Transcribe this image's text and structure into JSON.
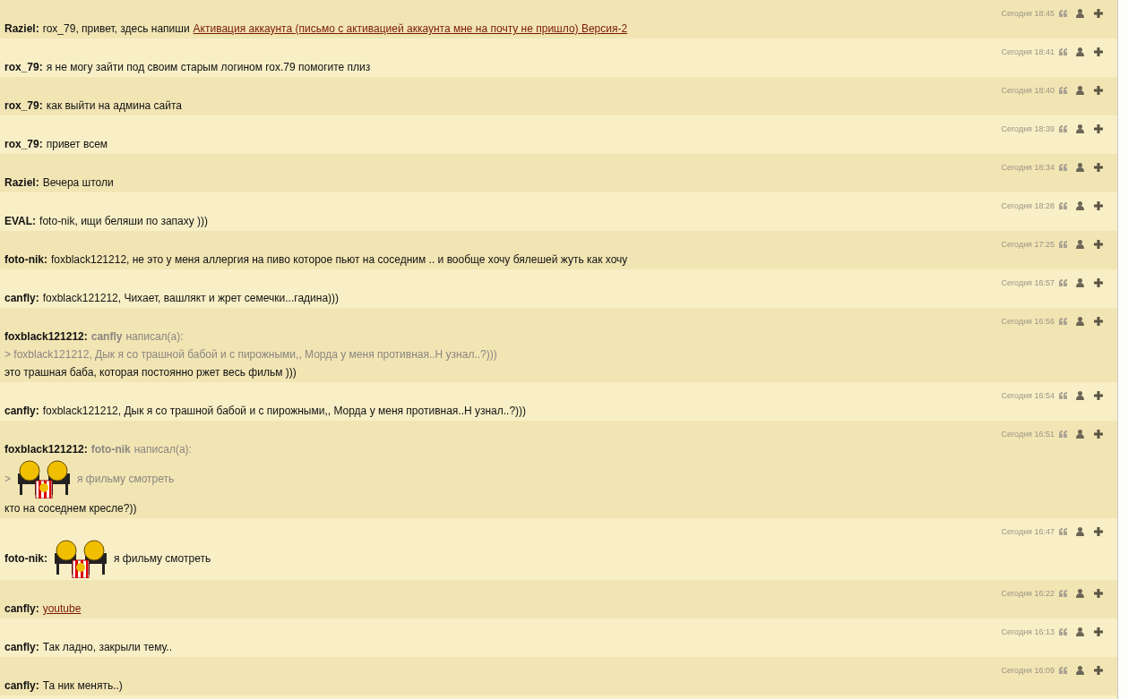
{
  "messages": [
    {
      "time": "Сегодня 18:45",
      "author": "Raziel:",
      "lines": [
        [
          {
            "kind": "text",
            "text": "rox_79, привет, здесь напиши"
          },
          {
            "kind": "link",
            "text": "Активация аккаунта (письмо с активацией аккаунта мне на почту не пришло) Версия-2"
          }
        ]
      ]
    },
    {
      "time": "Сегодня 18:41",
      "author": "rox_79:",
      "lines": [
        [
          {
            "kind": "text",
            "text": "я не могу зайти под своим старым логином rox.79 помогите плиз"
          }
        ]
      ]
    },
    {
      "time": "Сегодня 18:40",
      "author": "rox_79:",
      "lines": [
        [
          {
            "kind": "text",
            "text": "как выйти на админа сайта"
          }
        ]
      ]
    },
    {
      "time": "Сегодня 18:39",
      "author": "rox_79:",
      "lines": [
        [
          {
            "kind": "text",
            "text": "привет всем"
          }
        ]
      ]
    },
    {
      "time": "Сегодня 18:34",
      "author": "Raziel:",
      "lines": [
        [
          {
            "kind": "text",
            "text": "Вечера штоли"
          }
        ]
      ]
    },
    {
      "time": "Сегодня 18:28",
      "author": "EVAL:",
      "lines": [
        [
          {
            "kind": "text",
            "text": "foto-nik, ищи беляши по запаху )))"
          }
        ]
      ]
    },
    {
      "time": "Сегодня 17:25",
      "author": "foto-nik:",
      "lines": [
        [
          {
            "kind": "text",
            "text": "foxblack121212, не это у меня аллергия на пиво которое пьют на соседним .. и вообще хочу бялешей жуть как хочу"
          }
        ]
      ]
    },
    {
      "time": "Сегодня 16:57",
      "author": "canfly:",
      "lines": [
        [
          {
            "kind": "text",
            "text": "foxblack121212, Чихает, вашлякт и жрет семечки...гадина)))"
          }
        ]
      ]
    },
    {
      "time": "Сегодня 16:56",
      "author": "foxblack121212:",
      "lines": [
        [
          {
            "kind": "quote-author",
            "text": "canfly"
          },
          {
            "kind": "quote-text",
            "text": "написал(а):"
          }
        ],
        [
          {
            "kind": "quote-text",
            "text": "> foxblack121212, Дык я со трашной бабой и с пирожными,, Морда у меня противная..Н узнал..?)))"
          }
        ],
        [
          {
            "kind": "text",
            "text": "это трашная баба, которая постоянно ржет весь фильм )))"
          }
        ]
      ]
    },
    {
      "time": "Сегодня 16:54",
      "author": "canfly:",
      "lines": [
        [
          {
            "kind": "text",
            "text": "foxblack121212, Дык я со трашной бабой и с пирожными,, Морда у меня противная..Н узнал..?)))"
          }
        ]
      ]
    },
    {
      "time": "Сегодня 16:51",
      "author": "foxblack121212:",
      "lines": [
        [
          {
            "kind": "quote-author",
            "text": "foto-nik"
          },
          {
            "kind": "quote-text",
            "text": "написал(а):"
          }
        ],
        [
          {
            "kind": "quote-text",
            "text": ">"
          },
          {
            "kind": "emoticon"
          },
          {
            "kind": "quote-text",
            "text": "я фильму смотреть"
          }
        ],
        [
          {
            "kind": "text",
            "text": "кто на соседнем кресле?))"
          }
        ]
      ]
    },
    {
      "time": "Сегодня 16:47",
      "author": "foto-nik:",
      "lines": [
        [
          {
            "kind": "emoticon"
          },
          {
            "kind": "text",
            "text": "я фильму смотреть"
          }
        ]
      ]
    },
    {
      "time": "Сегодня 16:22",
      "author": "canfly:",
      "lines": [
        [
          {
            "kind": "link",
            "text": "youtube"
          }
        ]
      ]
    },
    {
      "time": "Сегодня 16:13",
      "author": "canfly:",
      "lines": [
        [
          {
            "kind": "text",
            "text": "Так ладно, закрыли тему.."
          }
        ]
      ]
    },
    {
      "time": "Сегодня 16:09",
      "author": "canfly:",
      "lines": [
        [
          {
            "kind": "text",
            "text": "Та ник менять..)"
          }
        ]
      ]
    }
  ]
}
